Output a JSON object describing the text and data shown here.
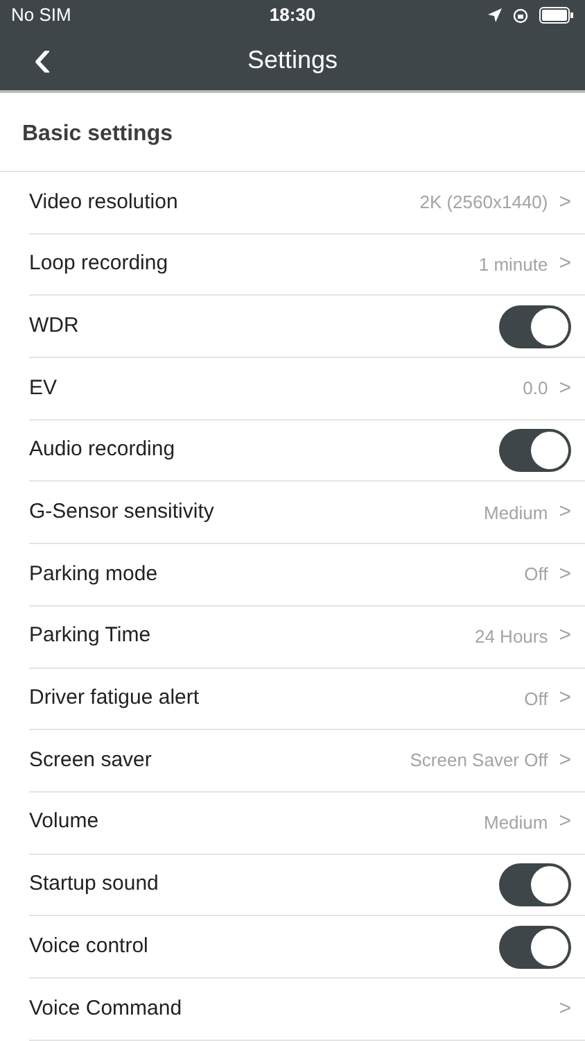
{
  "status_bar": {
    "carrier": "No SIM",
    "time": "18:30"
  },
  "nav": {
    "back": "‹",
    "title": "Settings"
  },
  "section": {
    "title": "Basic settings"
  },
  "rows": [
    {
      "kind": "link",
      "label": "Video resolution",
      "value": "2K (2560x1440)",
      "chevron": ">"
    },
    {
      "kind": "link",
      "label": "Loop recording",
      "value": "1 minute",
      "chevron": ">"
    },
    {
      "kind": "toggle",
      "label": "WDR",
      "on": true
    },
    {
      "kind": "link",
      "label": "EV",
      "value": "0.0",
      "chevron": ">"
    },
    {
      "kind": "toggle",
      "label": "Audio recording",
      "on": true
    },
    {
      "kind": "link",
      "label": "G-Sensor sensitivity",
      "value": "Medium",
      "chevron": ">"
    },
    {
      "kind": "link",
      "label": "Parking mode",
      "value": "Off",
      "chevron": ">"
    },
    {
      "kind": "link",
      "label": "Parking Time",
      "value": "24 Hours",
      "chevron": ">"
    },
    {
      "kind": "link",
      "label": "Driver fatigue alert",
      "value": "Off",
      "chevron": ">"
    },
    {
      "kind": "link",
      "label": "Screen saver",
      "value": "Screen Saver Off",
      "chevron": ">"
    },
    {
      "kind": "link",
      "label": "Volume",
      "value": "Medium",
      "chevron": ">"
    },
    {
      "kind": "toggle",
      "label": "Startup sound",
      "on": true
    },
    {
      "kind": "toggle",
      "label": "Voice control",
      "on": true
    },
    {
      "kind": "link",
      "label": "Voice Command",
      "chevron": ">"
    }
  ]
}
